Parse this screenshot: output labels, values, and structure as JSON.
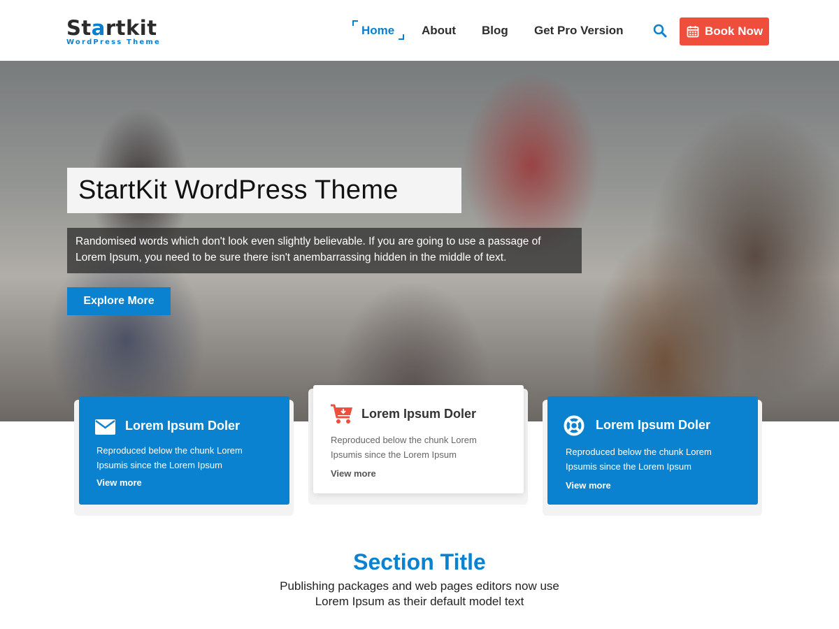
{
  "header": {
    "logo_main_start": "St",
    "logo_main_accent": "a",
    "logo_main_end": "rtkit",
    "logo_sub": "WordPress Theme",
    "nav": [
      {
        "label": "Home",
        "active": true
      },
      {
        "label": "About",
        "active": false
      },
      {
        "label": "Blog",
        "active": false
      },
      {
        "label": "Get Pro Version",
        "active": false
      }
    ],
    "search_icon": "search-icon",
    "book_button": {
      "label": "Book Now",
      "icon": "calendar-icon",
      "color": "#f04e3d"
    }
  },
  "hero": {
    "title": "StartKit WordPress Theme",
    "description": "Randomised words which don't look even slightly believable. If you are going to use a passage of Lorem Ipsum, you need to be sure there isn't anembarrassing hidden in the middle of text.",
    "button_label": "Explore More"
  },
  "features": [
    {
      "title": "Lorem Ipsum Doler",
      "text": "Reproduced below the chunk Lorem Ipsumis since the Lorem Ipsum",
      "link": "View more",
      "icon": "envelope-icon",
      "style": "blue"
    },
    {
      "title": "Lorem Ipsum Doler",
      "text": "Reproduced below the chunk Lorem Ipsumis since the Lorem Ipsum",
      "link": "View more",
      "icon": "cart-icon",
      "style": "white"
    },
    {
      "title": "Lorem Ipsum Doler",
      "text": "Reproduced below the chunk Lorem Ipsumis since the Lorem Ipsum",
      "link": "View more",
      "icon": "lifebuoy-icon",
      "style": "blue"
    }
  ],
  "section": {
    "title": "Section Title",
    "subtitle_line1": "Publishing  packages and web pages editors now use",
    "subtitle_line2": "Lorem Ipsum as their default  model text"
  },
  "colors": {
    "accent": "#0a82cf",
    "button_red": "#f04e3d"
  }
}
